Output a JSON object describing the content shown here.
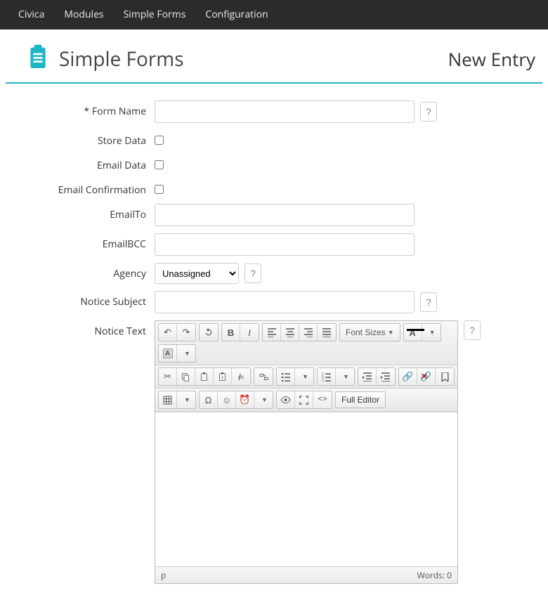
{
  "nav": {
    "items": [
      "Civica",
      "Modules",
      "Simple Forms",
      "Configuration"
    ]
  },
  "header": {
    "title": "Simple Forms",
    "subtitle": "New Entry"
  },
  "form": {
    "labels": {
      "form_name": "* Form Name",
      "store_data": "Store Data",
      "email_data": "Email Data",
      "email_confirmation": "Email Confirmation",
      "email_to": "EmailTo",
      "email_bcc": "EmailBCC",
      "agency": "Agency",
      "notice_subject": "Notice Subject",
      "notice_text": "Notice Text"
    },
    "values": {
      "form_name": "",
      "store_data": false,
      "email_data": false,
      "email_confirmation": false,
      "email_to": "",
      "email_bcc": "",
      "agency_selected": "Unassigned",
      "notice_subject": "",
      "notice_text": ""
    },
    "help_label": "?"
  },
  "editor": {
    "font_sizes_label": "Font Sizes",
    "full_editor_label": "Full Editor",
    "status_path": "p",
    "word_count_label": "Words: 0",
    "font_color_letter": "A",
    "highlight_letter": "A"
  }
}
